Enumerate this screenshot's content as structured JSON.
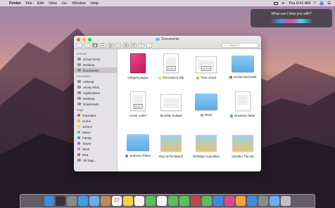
{
  "menubar": {
    "app_name": "Finder",
    "menus": [
      "File",
      "Edit",
      "View",
      "Go",
      "Window",
      "Help"
    ],
    "clock": "Thu 9:41 AM"
  },
  "siri": {
    "prompt": "What can I help you with?"
  },
  "window": {
    "title": "Documents",
    "search_placeholder": "Search"
  },
  "sidebar": {
    "sections": [
      {
        "heading": "iCloud",
        "items": [
          "iCloud Drive",
          "Desktop",
          "Documents"
        ]
      },
      {
        "heading": "Favorites",
        "items": [
          "AirDrop",
          "All My Files",
          "Applications",
          "Desktop",
          "Downloads"
        ]
      },
      {
        "heading": "Tags",
        "items": [
          "Important",
          "Home",
          "School",
          "Music",
          "Family",
          "Travel",
          "Work",
          "Red",
          "All Tags..."
        ]
      }
    ],
    "selected": "Documents",
    "tag_colors": [
      "#e04646",
      "#f2a33a",
      "#f2d13a",
      "#5ac05a",
      "#3a8ee0",
      "#a05ad0",
      "#9e9e9e",
      "#e04646"
    ]
  },
  "files": [
    {
      "name": "Origami.pages",
      "kind": "pages",
      "tag": ""
    },
    {
      "name": "Permission slip",
      "kind": "doc",
      "tag": "#f2d13a",
      "badge": "DOC"
    },
    {
      "name": "Time sheet",
      "kind": "xlsx",
      "tag": "#f2a33a",
      "badge": "XLSX"
    },
    {
      "name": "House Remodel",
      "kind": "folder",
      "tag": "#e04646"
    },
    {
      "name": "Cover Letter",
      "kind": "doc",
      "tag": "",
      "badge": "DOC"
    },
    {
      "name": "Monthly budget",
      "kind": "sheet",
      "tag": ""
    },
    {
      "name": "Work",
      "kind": "folder",
      "tag": "#9e9e9e"
    },
    {
      "name": "Business letter",
      "kind": "letter",
      "tag": "#3a8ee0"
    },
    {
      "name": "Summer Plans",
      "kind": "folder",
      "tag": "#3a8ee0"
    },
    {
      "name": "Day at the beach",
      "kind": "photo",
      "tag": ""
    },
    {
      "name": "Birthday Cupcakes",
      "kind": "photo",
      "tag": ""
    },
    {
      "name": "Geneko Trip.zip",
      "kind": "photo",
      "tag": ""
    }
  ],
  "dock": {
    "apps": [
      "finder-icon",
      "siri-icon",
      "launchpad-icon",
      "safari-icon",
      "mail-icon",
      "contacts-icon",
      "calendar-icon",
      "notes-icon",
      "reminders-icon",
      "maps-icon",
      "photos-icon",
      "messages-icon",
      "facetime-icon",
      "photobooth-icon",
      "numbers-icon",
      "keynote-icon",
      "itunes-icon",
      "ibooks-icon",
      "appstore-icon",
      "preferences-icon",
      "downloads-icon",
      "trash-icon"
    ],
    "colors": [
      "#3a8ee0",
      "#333340",
      "#8a8a8a",
      "#3aa0e8",
      "#6ab0f0",
      "#c08a50",
      "#f4f4f4",
      "#f2d13a",
      "#f4f4f4",
      "#5ac05a",
      "#f4f4f4",
      "#5ac05a",
      "#5ac05a",
      "#c04646",
      "#5ac05a",
      "#3a8ee0",
      "#e04690",
      "#f2a33a",
      "#3a8ee0",
      "#8a8a8a",
      "#6ab0f0",
      "#c0c0c0"
    ],
    "calendar_day": "27"
  }
}
